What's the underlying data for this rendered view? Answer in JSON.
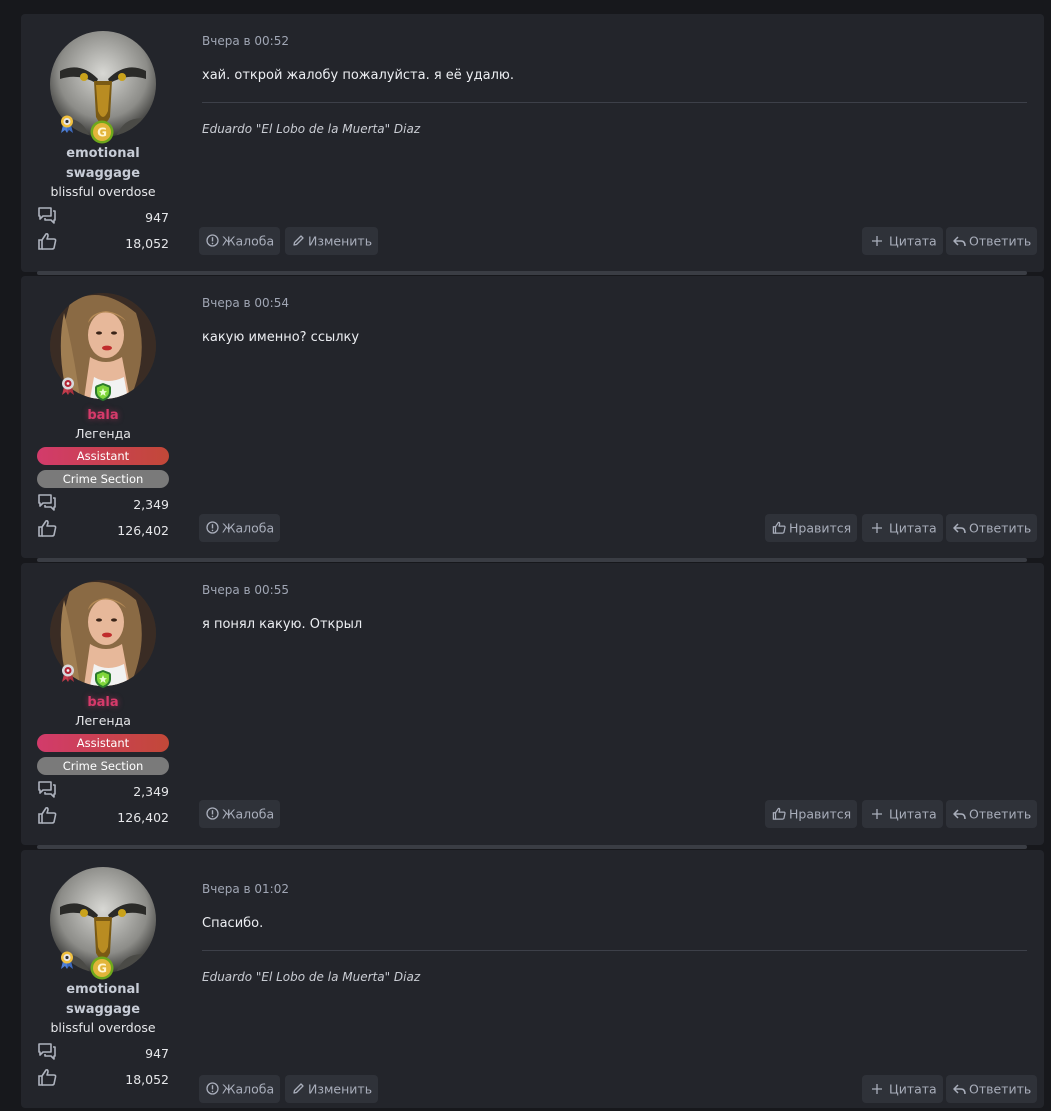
{
  "posts": [
    {
      "time": "Вчера в 00:52",
      "message": "хай. открой жалобу пожалуйста. я её удалю.",
      "signature": "Eduardo \"El Lobo de la Muerta\" Diaz",
      "user": {
        "name_line1": "emotional",
        "name_line2": "swaggage",
        "title": "blissful overdose",
        "messages": "947",
        "reactions": "18,052"
      },
      "buttons": {
        "report": "Жалоба",
        "edit": "Изменить",
        "quote": "Цитата",
        "reply": "Ответить"
      }
    },
    {
      "time": "Вчера в 00:54",
      "message": "какую именно? ссылку",
      "user": {
        "name": "bala",
        "title": "Легенда",
        "banners": [
          "Assistant",
          "Crime Section"
        ],
        "messages": "2,349",
        "reactions": "126,402"
      },
      "buttons": {
        "report": "Жалоба",
        "like": "Нравится",
        "quote": "Цитата",
        "reply": "Ответить"
      }
    },
    {
      "time": "Вчера в 00:55",
      "message": "я понял какую. Открыл",
      "user": {
        "name": "bala",
        "title": "Легенда",
        "banners": [
          "Assistant",
          "Crime Section"
        ],
        "messages": "2,349",
        "reactions": "126,402"
      },
      "buttons": {
        "report": "Жалоба",
        "like": "Нравится",
        "quote": "Цитата",
        "reply": "Ответить"
      }
    },
    {
      "time": "Вчера в 01:02",
      "message": "Спасибо.",
      "signature": "Eduardo \"El Lobo de la Muerta\" Diaz",
      "user": {
        "name_line1": "emotional",
        "name_line2": "swaggage",
        "title": "blissful overdose",
        "messages": "947",
        "reactions": "18,052"
      },
      "buttons": {
        "report": "Жалоба",
        "edit": "Изменить",
        "quote": "Цитата",
        "reply": "Ответить"
      }
    }
  ],
  "colors": {
    "page_bg": "#17181c",
    "post_bg": "#23252b",
    "username_light": "#c7ccd6",
    "username_pink": "#d63a6a",
    "banner_assistant": "#d23b6b",
    "banner_crime": "#7a7a7a",
    "button_bg": "#2f3239",
    "button_text": "#a9aebb"
  },
  "icons": {
    "messages": "chat-bubbles-icon",
    "reactions": "thumbs-up-icon",
    "report": "alert-circle-icon",
    "edit": "pencil-icon",
    "like": "thumbs-up-icon",
    "quote": "plus-icon",
    "reply": "reply-arrow-icon"
  }
}
